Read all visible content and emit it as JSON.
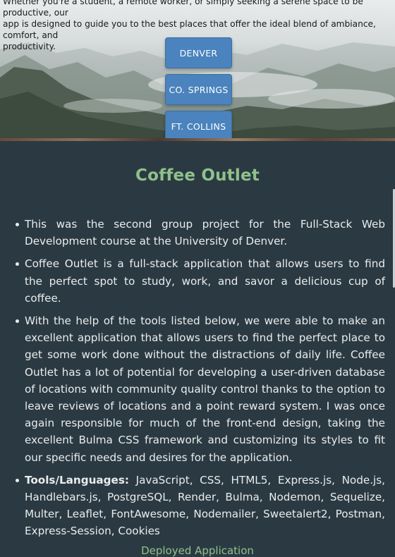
{
  "hero": {
    "intro_line1": "Whether you're a student, a remote worker, or simply seeking a serene space to be productive, our",
    "intro_line2": "app is designed to guide you to the best places that offer the ideal blend of ambiance, comfort, and",
    "intro_line3": "productivity.",
    "buttons": [
      {
        "label": "DENVER"
      },
      {
        "label": "CO. SPRINGS"
      },
      {
        "label": "FT. COLLINS"
      }
    ]
  },
  "project": {
    "title": "Coffee Outlet",
    "items": [
      {
        "text": "This was the second group project for the Full-Stack Web Development course at the University of Denver."
      },
      {
        "text": "Coffee Outlet is a full-stack application that allows users to find the perfect spot to study, work, and savor a delicious cup of coffee."
      },
      {
        "text": "With the help of the tools listed below, we were able to make an excellent application that allows users to find the perfect place to get some work done without the distractions of daily life. Coffee Outlet has a lot of potential for developing a user-driven database of locations with community quality control thanks to the option to leave reviews of locations and a point reward system. I was once again responsible for much of the front-end design, taking the excellent Bulma CSS framework and customizing its styles to fit our specific needs and desires for the application."
      }
    ],
    "tools_label": "Tools/Languages:",
    "tools_text": "JavaScript, CSS, HTML5, Express.js, Node.js, Handlebars.js, PostgreSQL, Render, Bulma, Nodemon, Sequelize, Multer, Leaflet, FontAwesome, Nodemailer, Sweetalert2, Postman, Express-Session, Cookies",
    "deployed_link": "Deployed Application"
  },
  "colors": {
    "background": "#2b3a42",
    "accent_green": "#8fc18c",
    "button_blue": "#4a83bd",
    "text": "#e9ecee"
  }
}
